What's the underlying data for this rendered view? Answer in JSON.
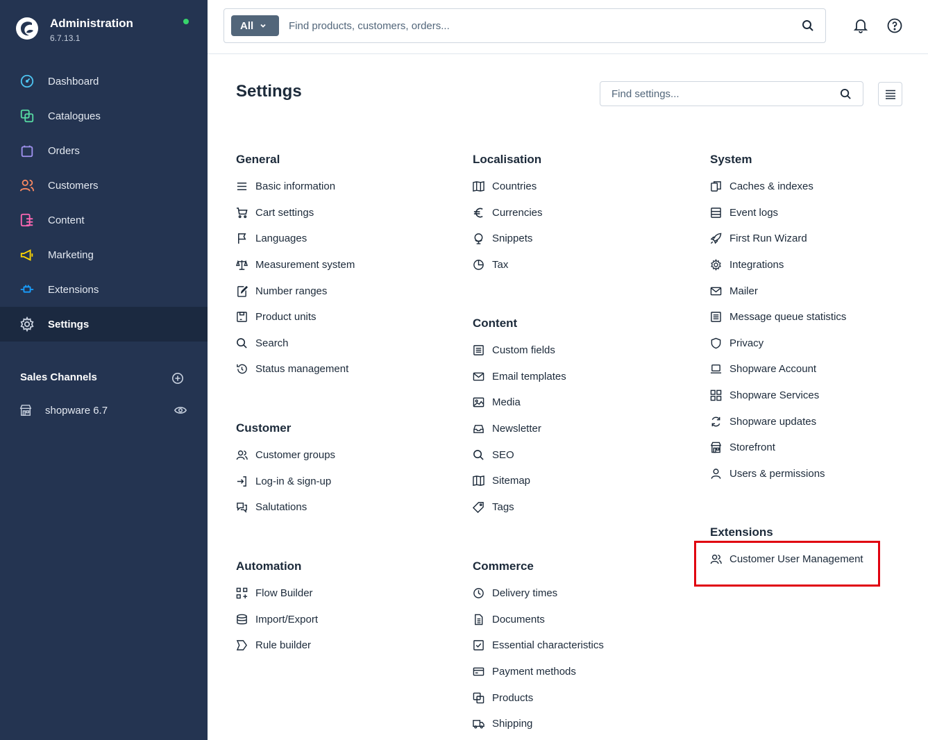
{
  "brand": {
    "title": "Administration",
    "version": "6.7.13.1",
    "status_color": "#37d46b"
  },
  "nav": [
    {
      "label": "Dashboard",
      "icon": "gauge-icon",
      "color": "#4dc3f0"
    },
    {
      "label": "Catalogues",
      "icon": "catalogue-icon",
      "color": "#57d9a3"
    },
    {
      "label": "Orders",
      "icon": "bag-icon",
      "color": "#a092f0"
    },
    {
      "label": "Customers",
      "icon": "customers-icon",
      "color": "#f88962"
    },
    {
      "label": "Content",
      "icon": "content-icon",
      "color": "#ff68b4"
    },
    {
      "label": "Marketing",
      "icon": "megaphone-icon",
      "color": "#ffd700"
    },
    {
      "label": "Extensions",
      "icon": "plug-icon",
      "color": "#189eff"
    },
    {
      "label": "Settings",
      "icon": "gear-icon",
      "color": "#c7d0de",
      "active": true
    }
  ],
  "sales_channels": {
    "title": "Sales Channels",
    "items": [
      {
        "label": "shopware 6.7"
      }
    ]
  },
  "topbar": {
    "type_label": "All",
    "search_placeholder": "Find products, customers, orders..."
  },
  "page": {
    "title": "Settings",
    "search_placeholder": "Find settings..."
  },
  "groups": {
    "general": {
      "title": "General",
      "items": [
        "Basic information",
        "Cart settings",
        "Languages",
        "Measurement system",
        "Number ranges",
        "Product units",
        "Search",
        "Status management"
      ]
    },
    "customer": {
      "title": "Customer",
      "items": [
        "Customer groups",
        "Log-in & sign-up",
        "Salutations"
      ]
    },
    "automation": {
      "title": "Automation",
      "items": [
        "Flow Builder",
        "Import/Export",
        "Rule builder"
      ]
    },
    "localisation": {
      "title": "Localisation",
      "items": [
        "Countries",
        "Currencies",
        "Snippets",
        "Tax"
      ]
    },
    "content": {
      "title": "Content",
      "items": [
        "Custom fields",
        "Email templates",
        "Media",
        "Newsletter",
        "SEO",
        "Sitemap",
        "Tags"
      ]
    },
    "commerce": {
      "title": "Commerce",
      "items": [
        "Delivery times",
        "Documents",
        "Essential characteristics",
        "Payment methods",
        "Products",
        "Shipping"
      ]
    },
    "system": {
      "title": "System",
      "items": [
        "Caches & indexes",
        "Event logs",
        "First Run Wizard",
        "Integrations",
        "Mailer",
        "Message queue statistics",
        "Privacy",
        "Shopware Account",
        "Shopware Services",
        "Shopware updates",
        "Storefront",
        "Users & permissions"
      ]
    },
    "extensions": {
      "title": "Extensions",
      "items": [
        "Customer User Management"
      ]
    }
  },
  "highlight_color": "#e0000f"
}
